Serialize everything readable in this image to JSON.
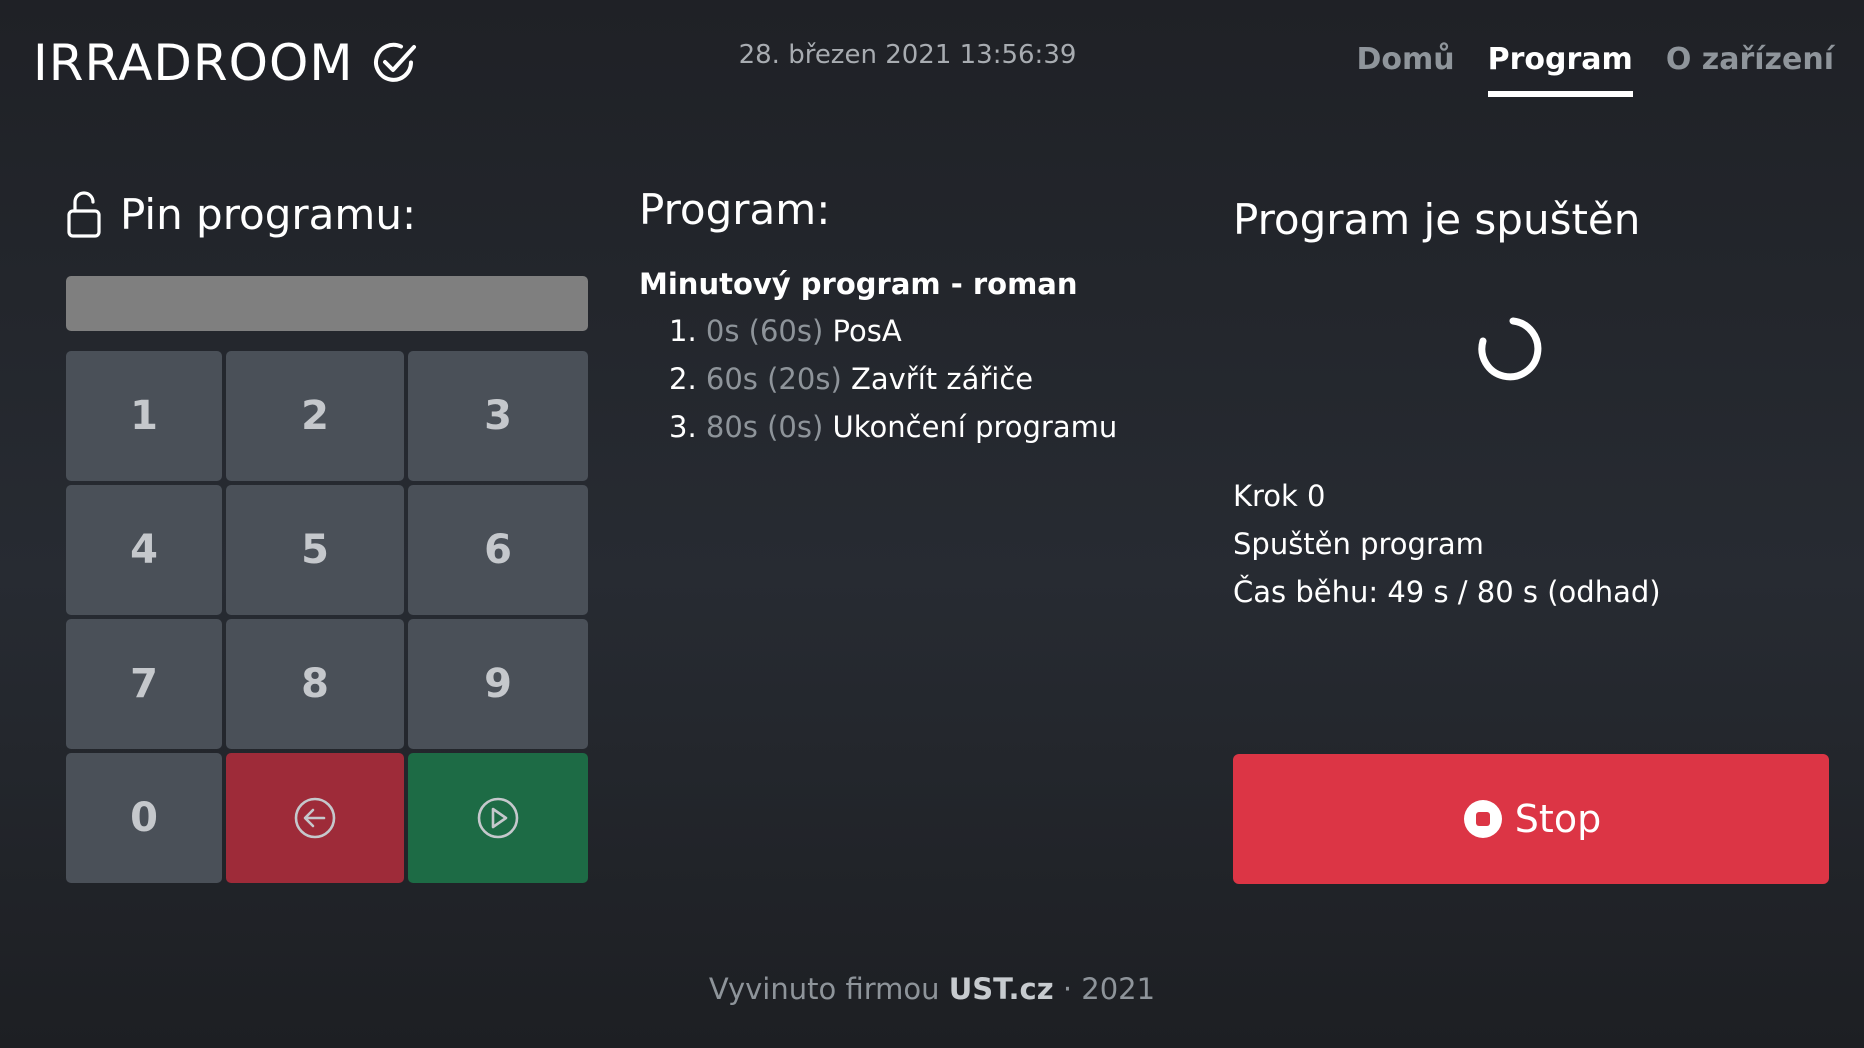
{
  "header": {
    "brand": "IRRADROOM",
    "datetime": "28. březen 2021 13:56:39",
    "nav": [
      {
        "label": "Domů"
      },
      {
        "label": "Program"
      },
      {
        "label": "O zařízení"
      }
    ]
  },
  "pin": {
    "title": "Pin programu:",
    "value": "",
    "keys": [
      "1",
      "2",
      "3",
      "4",
      "5",
      "6",
      "7",
      "8",
      "9",
      "0"
    ]
  },
  "program": {
    "title": "Program:",
    "name": "Minutový program - roman",
    "steps": [
      {
        "num": "1.",
        "time": "0s (60s)",
        "label": "PosA"
      },
      {
        "num": "2.",
        "time": "60s (20s)",
        "label": "Zavřít zářiče"
      },
      {
        "num": "3.",
        "time": "80s (0s)",
        "label": "Ukončení programu"
      }
    ]
  },
  "status": {
    "title": "Program je spuštěn",
    "step": "Krok 0",
    "state": "Spuštěn program",
    "runtime": "Čas běhu: 49 s / 80 s (odhad)",
    "stop_label": "Stop"
  },
  "footer": {
    "prefix": "Vyvinuto firmou",
    "company": "UST.cz",
    "suffix": "· 2021"
  },
  "colors": {
    "stop": "#dc3545",
    "delete_key": "#9e2b39",
    "confirm_key": "#1d6b45",
    "key": "#4a5058"
  }
}
